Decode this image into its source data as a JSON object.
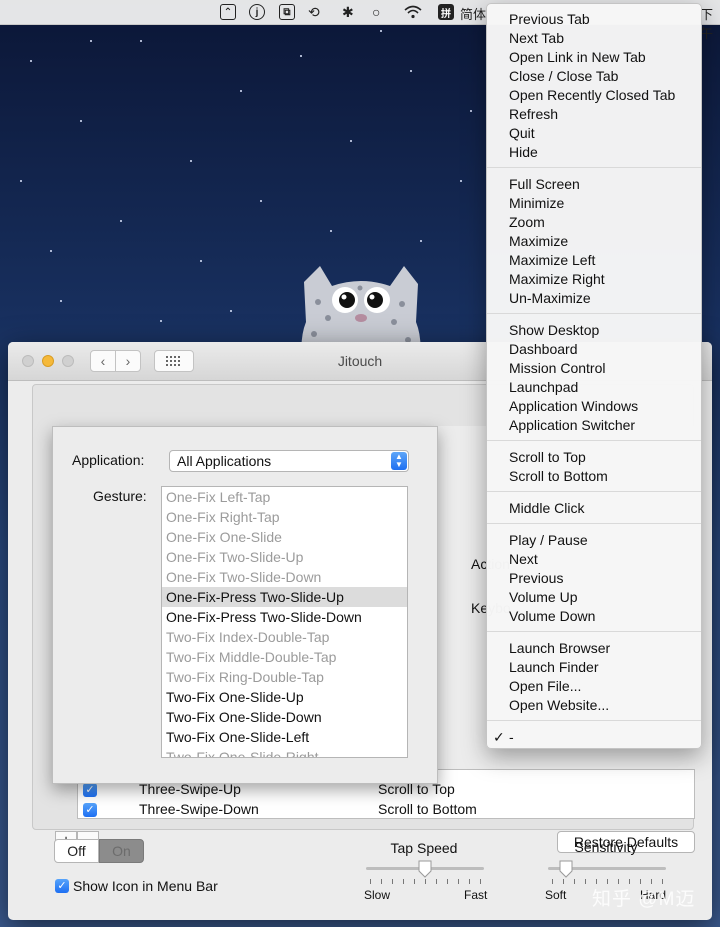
{
  "menubar": {
    "ime_glyph": "拼",
    "ime_label": "简体",
    "clock_fragment": "下午"
  },
  "window": {
    "title": "Jitouch"
  },
  "editor": {
    "application_label": "Application:",
    "application_value": "All Applications",
    "gesture_label": "Gesture:",
    "gestures": [
      {
        "label": "One-Fix Left-Tap",
        "state": "dis"
      },
      {
        "label": "One-Fix Right-Tap",
        "state": "dis"
      },
      {
        "label": "One-Fix One-Slide",
        "state": "dis"
      },
      {
        "label": "One-Fix Two-Slide-Up",
        "state": "dis"
      },
      {
        "label": "One-Fix Two-Slide-Down",
        "state": "dis"
      },
      {
        "label": "One-Fix-Press Two-Slide-Up",
        "state": "sel"
      },
      {
        "label": "One-Fix-Press Two-Slide-Down",
        "state": "en"
      },
      {
        "label": "Two-Fix Index-Double-Tap",
        "state": "dis"
      },
      {
        "label": "Two-Fix Middle-Double-Tap",
        "state": "dis"
      },
      {
        "label": "Two-Fix Ring-Double-Tap",
        "state": "dis"
      },
      {
        "label": "Two-Fix One-Slide-Up",
        "state": "en"
      },
      {
        "label": "Two-Fix One-Slide-Down",
        "state": "en"
      },
      {
        "label": "Two-Fix One-Slide-Left",
        "state": "en"
      },
      {
        "label": "Two-Fix One-Slide-Right",
        "state": "dis"
      }
    ],
    "action_label": "Action",
    "keyboard_label": "Keybo"
  },
  "table": {
    "rows": [
      {
        "gesture": "Three-Swipe-Up",
        "action": "Scroll to Top"
      },
      {
        "gesture": "Three-Swipe-Down",
        "action": "Scroll to Bottom"
      }
    ]
  },
  "buttons": {
    "add": "+",
    "remove": "−",
    "restore": "Restore Defaults"
  },
  "toggle": {
    "off": "Off",
    "on": "On",
    "selected": "Off"
  },
  "show_icon": {
    "label": "Show Icon in Menu Bar",
    "checked": true
  },
  "tap_speed": {
    "title": "Tap Speed",
    "min_label": "Slow",
    "max_label": "Fast",
    "value": 0.5
  },
  "sensitivity": {
    "title": "Sensitivity",
    "min_label": "Soft",
    "max_label": "Hard",
    "value": 0.15
  },
  "menu": {
    "groups": [
      [
        "Previous Tab",
        "Next Tab",
        "Open Link in New Tab",
        "Close / Close Tab",
        "Open Recently Closed Tab",
        "Refresh",
        "Quit",
        "Hide"
      ],
      [
        "Full Screen",
        "Minimize",
        "Zoom",
        "Maximize",
        "Maximize Left",
        "Maximize Right",
        "Un-Maximize"
      ],
      [
        "Show Desktop",
        "Dashboard",
        "Mission Control",
        "Launchpad",
        "Application Windows",
        "Application Switcher"
      ],
      [
        "Scroll to Top",
        "Scroll to Bottom"
      ],
      [
        "Middle Click"
      ],
      [
        "Play / Pause",
        "Next",
        "Previous",
        "Volume Up",
        "Volume Down"
      ],
      [
        "Launch Browser",
        "Launch Finder",
        "Open File...",
        "Open Website..."
      ],
      [
        "-"
      ]
    ],
    "checked_item": "-"
  },
  "watermark": "知乎 @M迈",
  "colors": {
    "accent": "#1d6ff2",
    "selection": "#dcdcdc",
    "disabled_text": "#9b9b9b"
  }
}
